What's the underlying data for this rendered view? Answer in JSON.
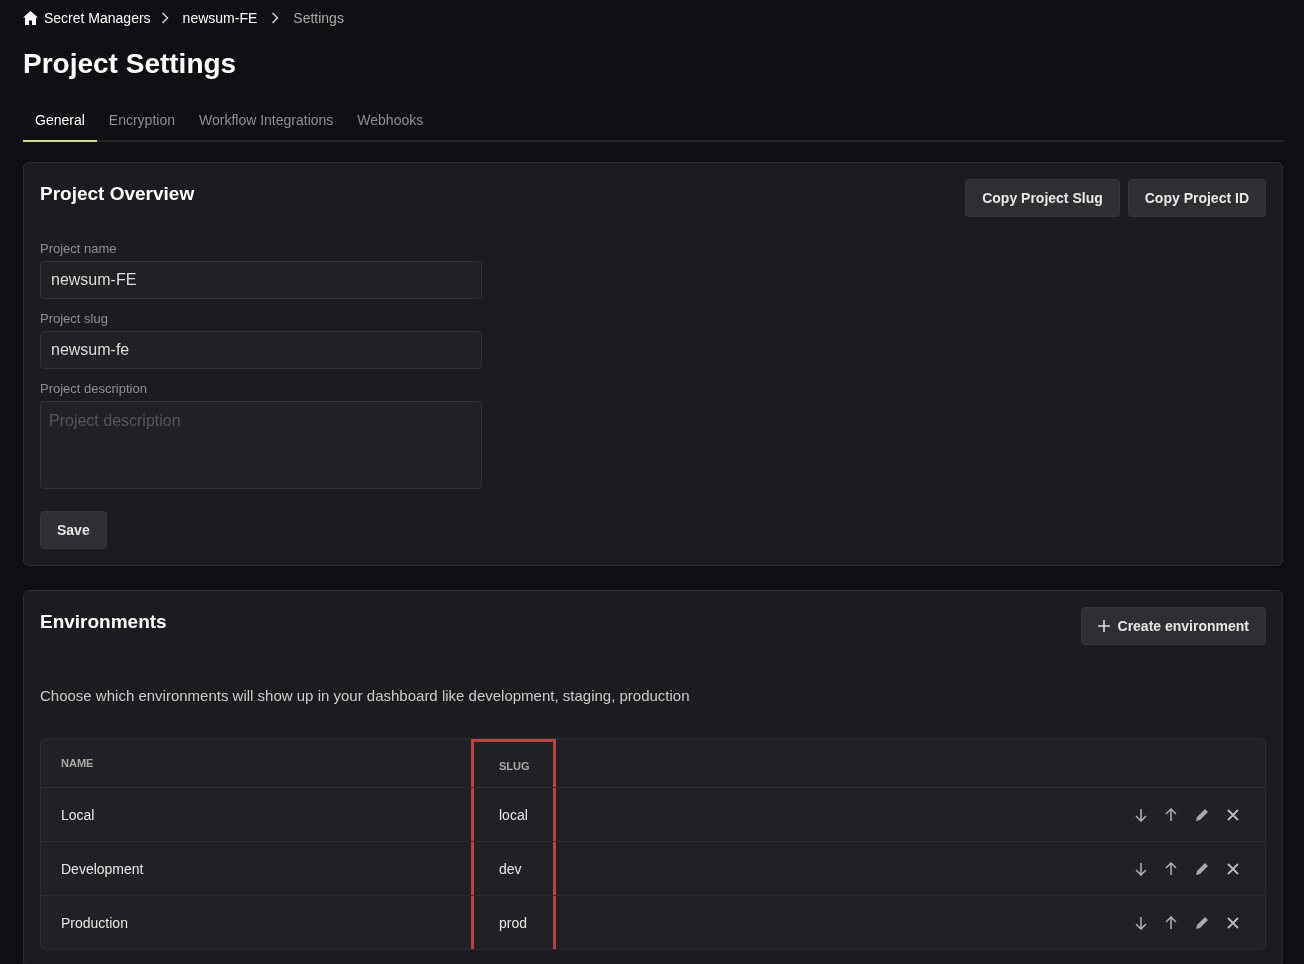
{
  "breadcrumb": [
    {
      "label": "Secret Managers",
      "kind": "home"
    },
    {
      "label": "newsum-FE",
      "kind": "current"
    },
    {
      "label": "Settings",
      "kind": "muted"
    }
  ],
  "title": "Project Settings",
  "tabs": [
    {
      "label": "General",
      "selected": true
    },
    {
      "label": "Encryption",
      "selected": false
    },
    {
      "label": "Workflow Integrations",
      "selected": false
    },
    {
      "label": "Webhooks",
      "selected": false
    }
  ],
  "overview": {
    "title": "Project Overview",
    "buttons": [
      "Copy Project Slug",
      "Copy Project ID"
    ],
    "fields": [
      {
        "label": "Project name",
        "value": "newsum-FE",
        "kind": "input"
      },
      {
        "label": "Project slug",
        "value": "newsum-fe",
        "kind": "input"
      },
      {
        "label": "Project description",
        "placeholder": "Project description",
        "kind": "textarea"
      }
    ],
    "save": "Save"
  },
  "environments": {
    "title": "Environments",
    "create_button": "Create environment",
    "description": "Choose which environments will show up in your dashboard like development, staging, production",
    "table": {
      "columns": [
        {
          "label": "NAME",
          "highlighted": false
        },
        {
          "label": "SLUG",
          "highlighted": true
        }
      ],
      "rows": [
        {
          "name": "Local",
          "slug": "local"
        },
        {
          "name": "Development",
          "slug": "dev"
        },
        {
          "name": "Production",
          "slug": "prod"
        }
      ]
    }
  }
}
